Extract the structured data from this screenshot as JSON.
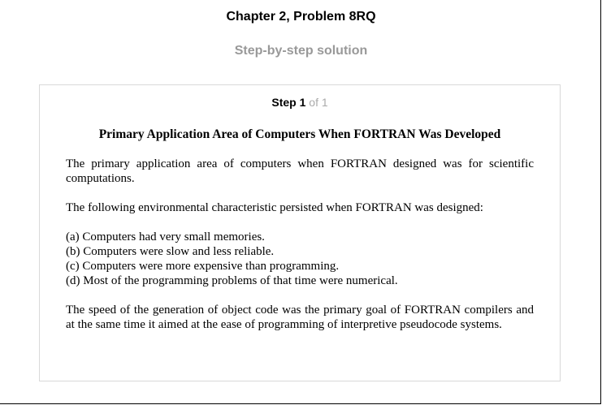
{
  "header": {
    "chapter_title": "Chapter 2, Problem 8RQ",
    "subtitle": "Step-by-step solution"
  },
  "step": {
    "label": "Step",
    "number": "1",
    "of_text": "of 1"
  },
  "solution": {
    "heading": "Primary Application Area of Computers When FORTRAN Was Developed",
    "paragraph1": "The primary application area of computers when FORTRAN designed was for scientific computations.",
    "paragraph2": "The following environmental characteristic persisted when FORTRAN was designed:",
    "list": [
      "(a) Computers had very small memories.",
      "(b) Computers were slow and less reliable.",
      "(c) Computers were more expensive than programming.",
      "(d) Most of the programming problems of that time were numerical."
    ],
    "paragraph3": "The speed of the generation of object code was the primary goal of FORTRAN compilers and at the same time it aimed at the ease of programming of interpretive pseudocode systems."
  }
}
